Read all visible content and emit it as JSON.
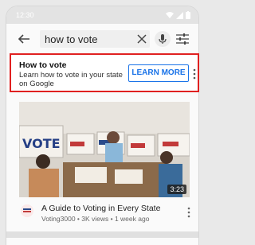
{
  "status_bar": {
    "time": "12:30"
  },
  "search": {
    "query": "how to vote"
  },
  "icons": {
    "back": "arrow-back-icon",
    "clear": "close-icon",
    "mic": "mic-icon",
    "filters": "tune-icon",
    "overflow": "more-vert-icon"
  },
  "banner": {
    "title": "How to vote",
    "description": "Learn how to vote in your state on Google",
    "button_label": "LEARN MORE"
  },
  "video": {
    "duration": "3:23",
    "title": "A Guide to Voting in Every State",
    "subtitle": "Voting3000 • 3K views • 1 week ago"
  },
  "colors": {
    "highlight_border": "#e02020",
    "accent": "#1a73e8"
  }
}
